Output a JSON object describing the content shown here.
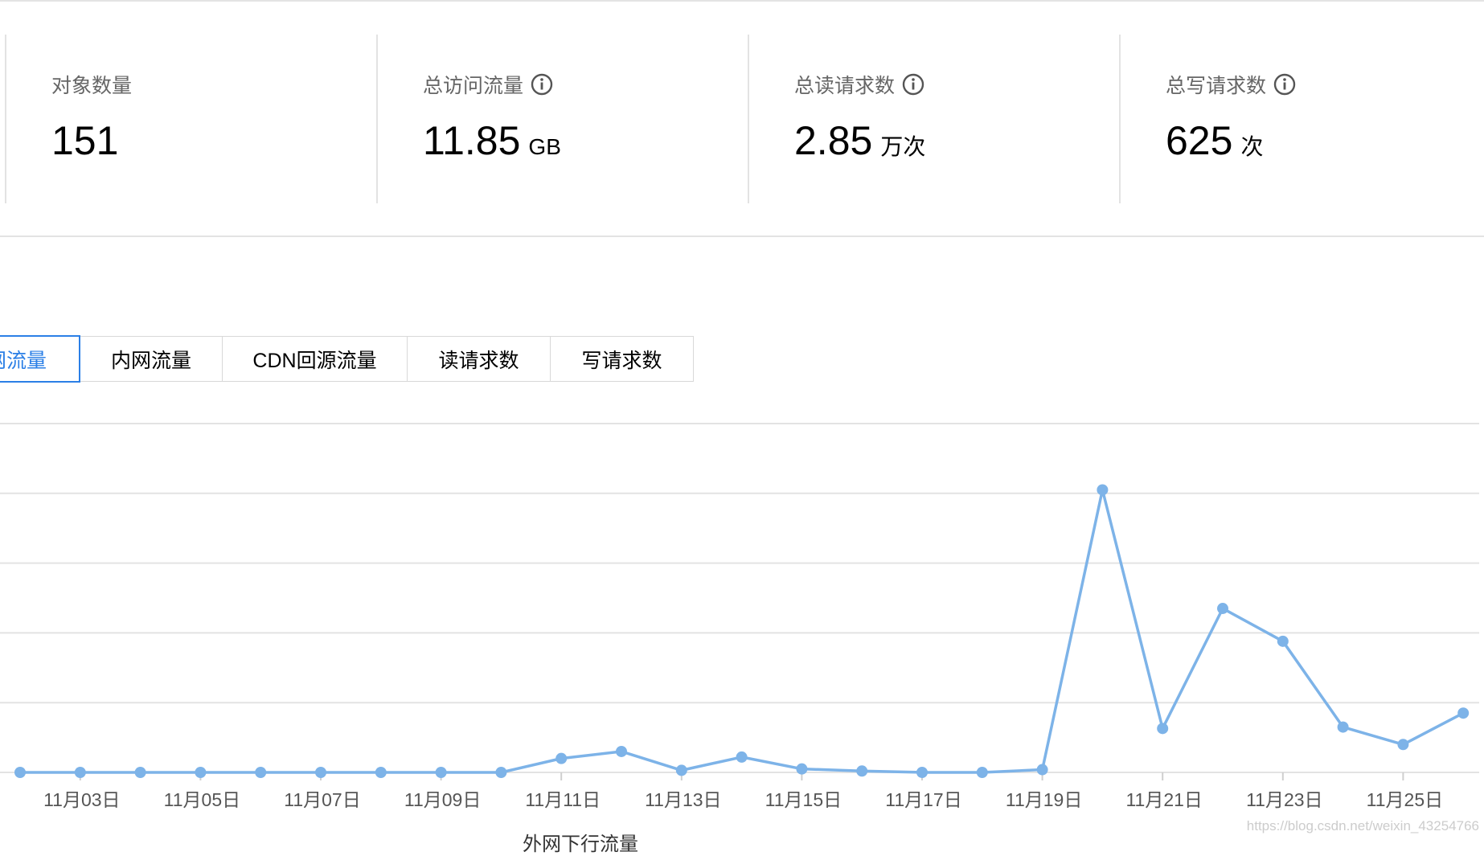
{
  "stats": [
    {
      "label": "对象数量",
      "value": "151",
      "unit": "",
      "info": false
    },
    {
      "label": "总访问流量",
      "value": "11.85",
      "unit": "GB",
      "info": true
    },
    {
      "label": "总读请求数",
      "value": "2.85",
      "unit": "万次",
      "info": true
    },
    {
      "label": "总写请求数",
      "value": "625",
      "unit": "次",
      "info": true
    }
  ],
  "tabs": [
    {
      "label": "外网流量",
      "active": true
    },
    {
      "label": "内网流量",
      "active": false
    },
    {
      "label": "CDN回源流量",
      "active": false
    },
    {
      "label": "读请求数",
      "active": false
    },
    {
      "label": "写请求数",
      "active": false
    }
  ],
  "colors": {
    "accent": "#2b7fe6",
    "series": "#7db3e8",
    "grid": "#e3e3e3"
  },
  "icons": {
    "info": "info-circle-icon"
  },
  "chart_data": {
    "type": "line",
    "x": [
      "11月02日",
      "11月03日",
      "11月04日",
      "11月05日",
      "11月06日",
      "11月07日",
      "11月08日",
      "11月09日",
      "11月10日",
      "11月11日",
      "11月12日",
      "11月13日",
      "11月14日",
      "11月15日",
      "11月16日",
      "11月17日",
      "11月18日",
      "11月19日",
      "11月20日",
      "11月21日",
      "11月22日",
      "11月23日",
      "11月24日",
      "11月25日",
      "11月26日"
    ],
    "tick_labels": [
      "11月03日",
      "11月05日",
      "11月07日",
      "11月09日",
      "11月11日",
      "11月13日",
      "11月15日",
      "11月17日",
      "11月19日",
      "11月21日",
      "11月23日",
      "11月25日"
    ],
    "series": [
      {
        "name": "外网下行流量",
        "values": [
          0,
          0,
          0,
          0,
          0,
          0,
          0,
          0,
          0,
          0.2,
          0.3,
          0.03,
          0.22,
          0.05,
          0.02,
          0,
          0,
          0.04,
          4.05,
          0.63,
          2.35,
          1.88,
          0.65,
          0.4,
          0.85
        ]
      }
    ],
    "ylim": [
      0,
      5
    ],
    "y_gridlines": [
      0,
      1,
      2,
      3,
      4,
      5
    ],
    "grid": true,
    "legend": "bottom"
  },
  "watermark": "https://blog.csdn.net/weixin_43254766"
}
